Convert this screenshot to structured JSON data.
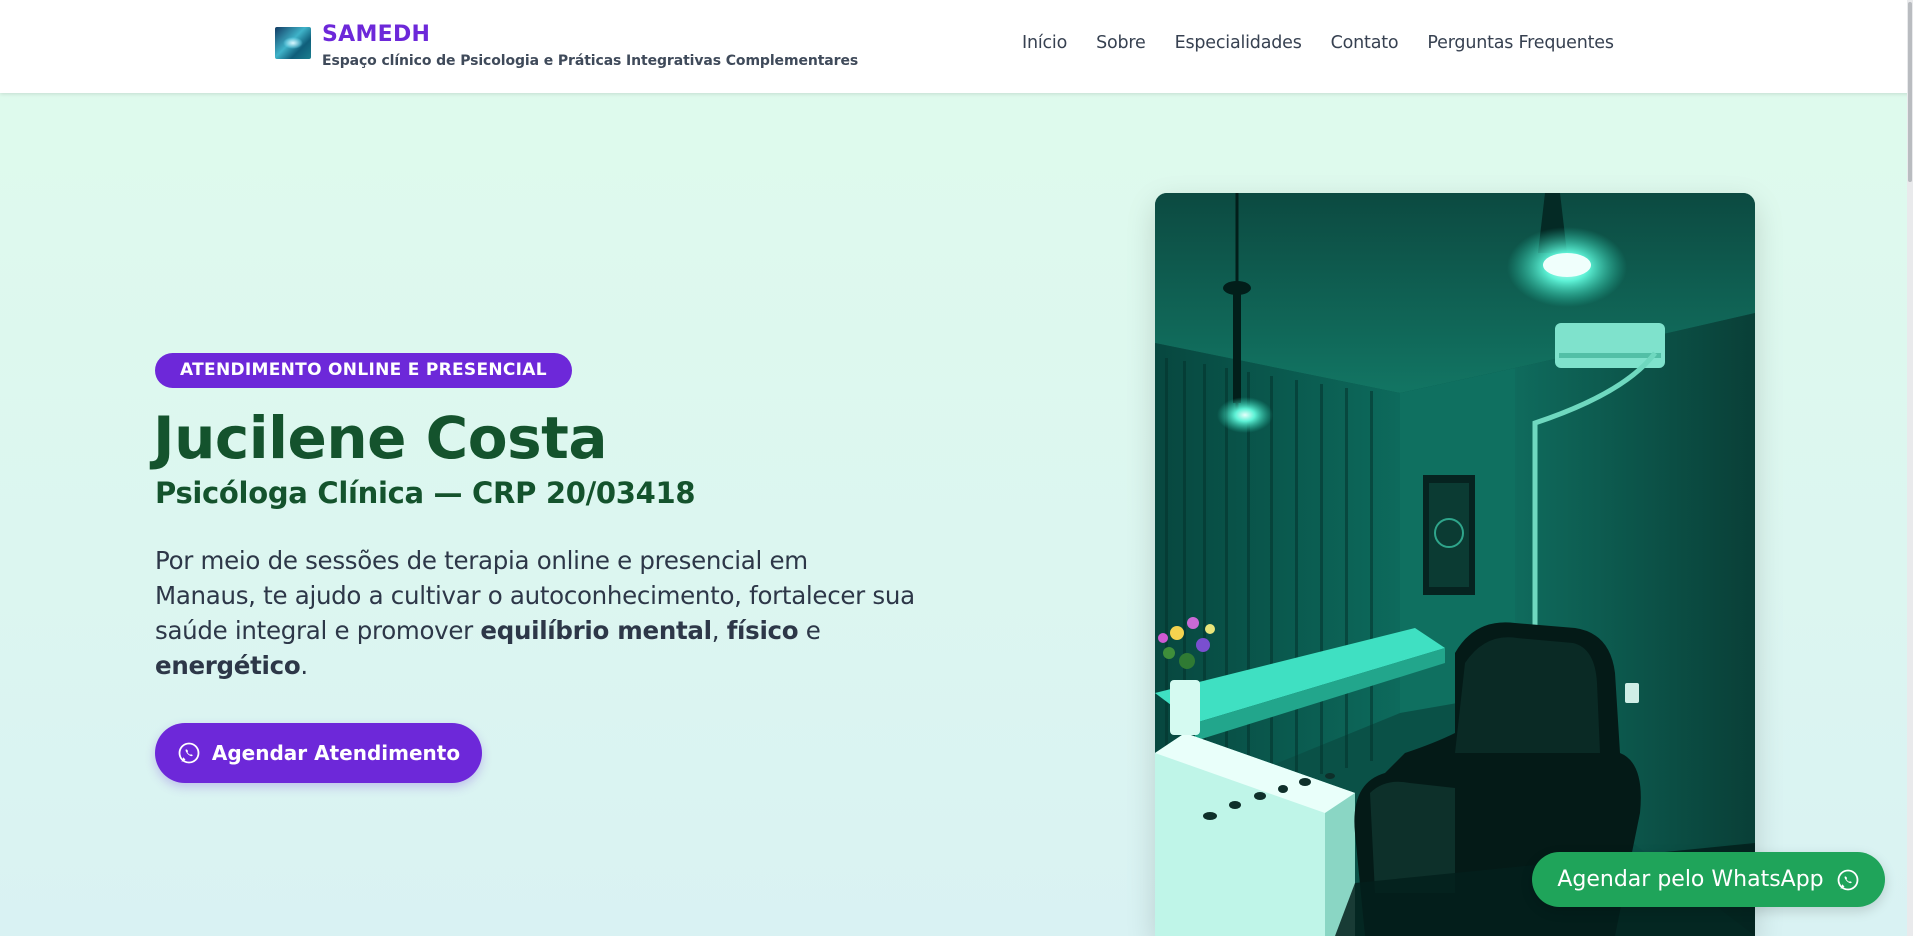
{
  "header": {
    "brand_name": "SAMEDH",
    "tagline": "Espaço clínico de Psicologia e Práticas Integrativas Complementares",
    "logo_icon": "samedh-logo"
  },
  "nav": {
    "items": [
      {
        "label": "Início"
      },
      {
        "label": "Sobre"
      },
      {
        "label": "Especialidades"
      },
      {
        "label": "Contato"
      },
      {
        "label": "Perguntas Frequentes"
      }
    ]
  },
  "hero": {
    "badge": "ATENDIMENTO ONLINE E PRESENCIAL",
    "name": "Jucilene Costa",
    "subtitle": "Psicóloga Clínica — CRP 20/03418",
    "text_intro": "Por meio de sessões de terapia online e presencial em Manaus, te ajudo a cultivar o autoconhecimento, fortalecer sua saúde integral e promover ",
    "text_bold_1": "equilíbrio mental",
    "text_sep": ", ",
    "text_bold_2": "físico",
    "text_and": " e ",
    "text_bold_3": "energético",
    "text_end": ".",
    "cta_label": "Agendar Atendimento",
    "cta_icon": "whatsapp-icon",
    "photo_icon": "therapy-room-photo"
  },
  "floating": {
    "label": "Agendar pelo WhatsApp",
    "icon": "whatsapp-icon"
  },
  "colors": {
    "brand": "#6d28d9",
    "heading": "#14532d",
    "whatsapp": "#1fa45a",
    "background_top": "#dffbec",
    "background_bottom": "#d9f2f3"
  }
}
